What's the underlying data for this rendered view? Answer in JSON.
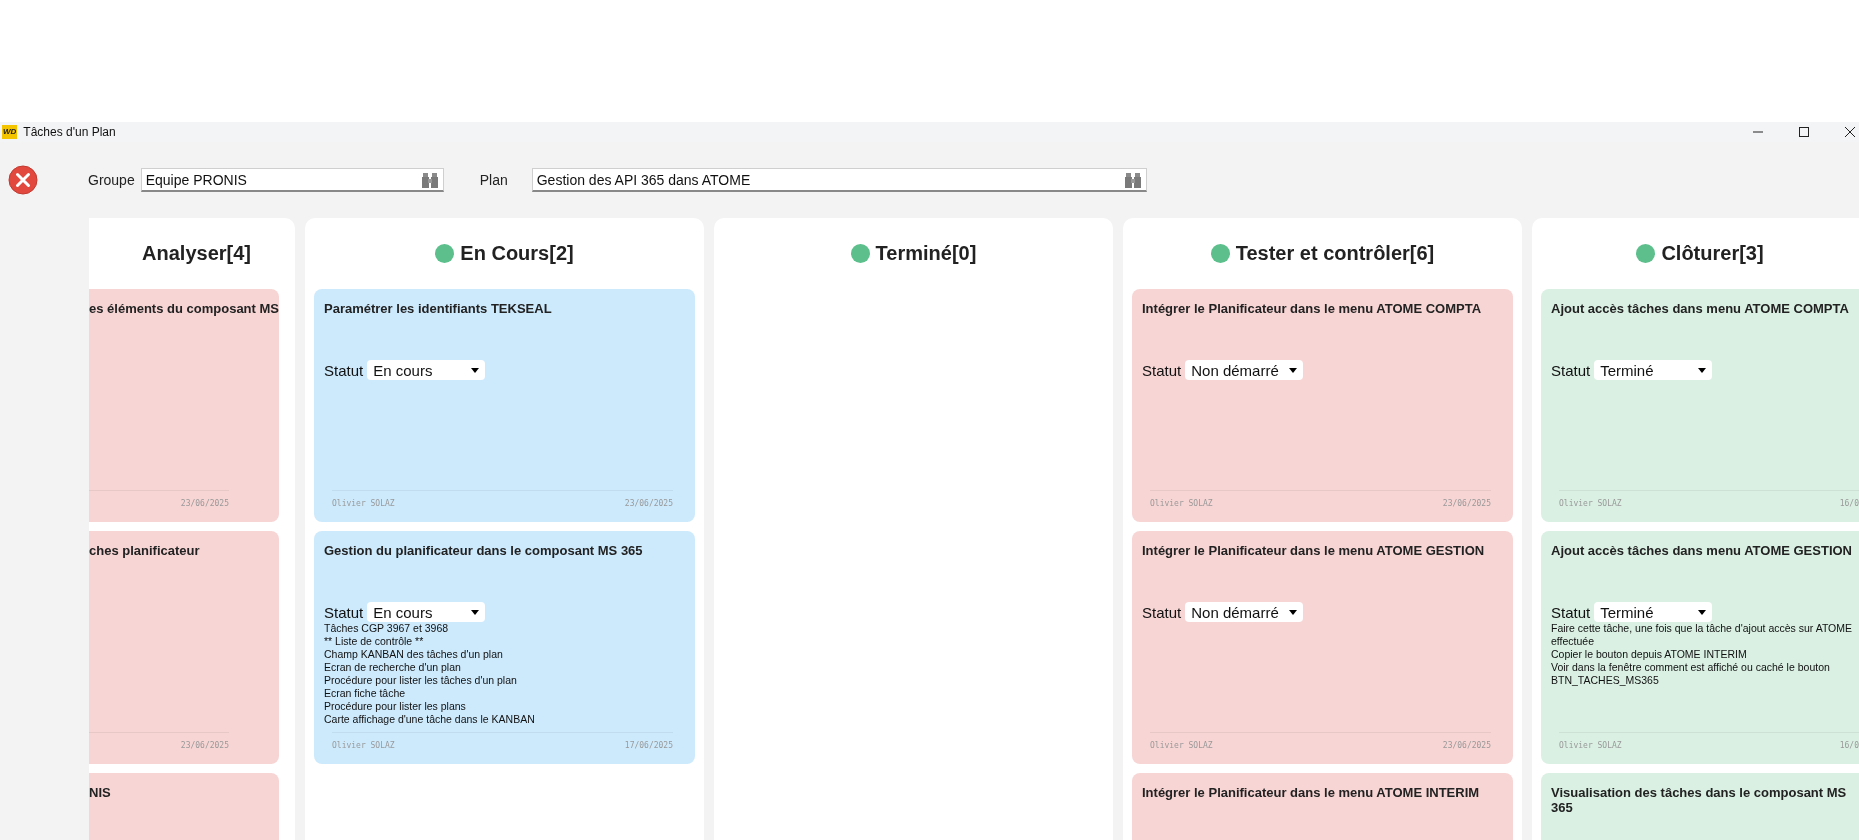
{
  "window": {
    "icon_text": "WD",
    "title": "Tâches d'un Plan"
  },
  "toolbar": {
    "fields": [
      {
        "label": "Groupe",
        "value": "Equipe PRONIS"
      },
      {
        "label": "Plan",
        "value": "Gestion des API 365 dans ATOME"
      }
    ]
  },
  "columns": [
    {
      "title": "Analyser[4]",
      "dot": false,
      "cards": [
        {
          "title": "es éléments du composant MS",
          "color": "#f7d5d4",
          "date": "23/06/2025"
        },
        {
          "title": "ches planificateur",
          "color": "#f7d5d4",
          "date": "23/06/2025"
        },
        {
          "title": "NIS",
          "color": "#f7d5d4"
        }
      ]
    },
    {
      "title": "En Cours[2]",
      "dot": true,
      "cards": [
        {
          "title": "Paramétrer les identifiants TEKSEAL",
          "color": "#cdeafd",
          "status_label": "Statut",
          "status": "En cours",
          "author": "Olivier SOLAZ",
          "date": "23/06/2025"
        },
        {
          "title": "Gestion du planificateur dans le composant MS 365",
          "color": "#cdeafd",
          "status_label": "Statut",
          "status": "En cours",
          "description": [
            "Tâches CGP 3967 et 3968",
            "** Liste de contrôle **",
            "Champ KANBAN des tâches d'un plan",
            "Ecran de recherche d'un plan",
            "Procédure pour lister les tâches d'un plan",
            "Ecran fiche tâche",
            "Procédure pour lister les plans",
            "Carte affichage d'une tâche dans le KANBAN"
          ],
          "author": "Olivier SOLAZ",
          "date": "17/06/2025"
        }
      ]
    },
    {
      "title": "Terminé[0]",
      "dot": true
    },
    {
      "title": "Tester et contrôler[6]",
      "dot": true,
      "cards": [
        {
          "title": "Intégrer le Planificateur dans le menu ATOME COMPTA",
          "color": "#f7d5d4",
          "status_label": "Statut",
          "status": "Non démarré",
          "author": "Olivier SOLAZ",
          "date": "23/06/2025"
        },
        {
          "title": "Intégrer le Planificateur dans le menu ATOME GESTION",
          "color": "#f7d5d4",
          "status_label": "Statut",
          "status": "Non démarré",
          "author": "Olivier SOLAZ",
          "date": "23/06/2025"
        },
        {
          "title": "Intégrer le Planificateur dans le menu ATOME INTERIM",
          "color": "#f7d5d4"
        }
      ]
    },
    {
      "title": "Clôturer[3]",
      "dot": true,
      "cards": [
        {
          "title": "Ajout accès tâches dans menu ATOME COMPTA",
          "color": "#daf0e3",
          "status_label": "Statut",
          "status": "Terminé",
          "author": "Olivier SOLAZ",
          "date": "16/0"
        },
        {
          "title": "Ajout accès tâches dans menu ATOME GESTION",
          "color": "#daf0e3",
          "status_label": "Statut",
          "status": "Terminé",
          "description": [
            "Faire cette tâche, une fois que la tâche d'ajout accès sur ATOME",
            "effectuée",
            "Copier le bouton depuis ATOME INTERIM",
            "Voir dans la fenêtre comment est affiché ou caché le bouton",
            "BTN_TACHES_MS365"
          ],
          "author": "Olivier SOLAZ",
          "date": "16/0"
        },
        {
          "title": "Visualisation des tâches dans le composant MS 365",
          "color": "#daf0e3"
        }
      ]
    }
  ]
}
